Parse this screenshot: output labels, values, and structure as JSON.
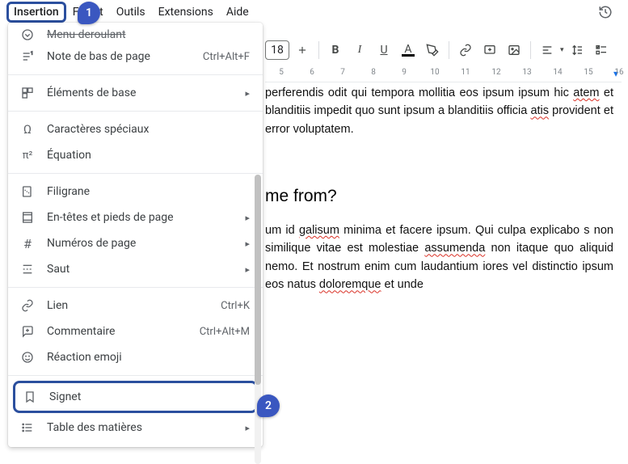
{
  "menubar": {
    "insertion": "Insertion",
    "format_partial_left": "F",
    "format_partial_right": "at",
    "outils": "Outils",
    "extensions": "Extensions",
    "aide": "Aide"
  },
  "badges": {
    "one": "1",
    "two": "2"
  },
  "toolbar": {
    "font_size": "18",
    "bold_glyph": "B",
    "italic_glyph": "I",
    "underline_glyph": "U",
    "text_color_glyph": "A"
  },
  "dropdown": {
    "truncated_top": "Menu deroulant",
    "footnote": {
      "label": "Note de bas de page",
      "shortcut": "Ctrl+Alt+F"
    },
    "building_blocks": {
      "label": "Éléments de base"
    },
    "special_chars": {
      "label": "Caractères spéciaux"
    },
    "equation": {
      "label": "Équation"
    },
    "watermark": {
      "label": "Filigrane"
    },
    "headers_footers": {
      "label": "En-têtes et pieds de page"
    },
    "page_numbers": {
      "label": "Numéros de page"
    },
    "break": {
      "label": "Saut"
    },
    "link": {
      "label": "Lien",
      "shortcut": "Ctrl+K"
    },
    "comment": {
      "label": "Commentaire",
      "shortcut": "Ctrl+Alt+M"
    },
    "emoji": {
      "label": "Réaction emoji"
    },
    "bookmark": {
      "label": "Signet"
    },
    "toc": {
      "label": "Table des matières"
    }
  },
  "ruler": {
    "ticks": [
      "5",
      "6",
      "7",
      "8",
      "9",
      "10",
      "11",
      "12",
      "13",
      "14",
      "15",
      "16"
    ]
  },
  "doc": {
    "p1_a": "perferendis odit qui tempora mollitia eos ipsum ipsum hic ",
    "p1_b": "atem",
    "p1_c": " et blanditiis impedit quo sunt ipsum a blanditiis officia ",
    "p1_d": "atis",
    "p1_e": " provident et error voluptatem.",
    "h2": "me from?",
    "p2_a": "um id ",
    "p2_w1": "galisum",
    "p2_b": " minima et facere ipsum. Qui culpa explicabo s non similique vitae est molestiae ",
    "p2_w2": "assumenda",
    "p2_c": " non itaque quo aliquid nemo. Et nostrum enim cum laudantium iores vel distinctio ipsum eos natus ",
    "p2_w3": "doloremque",
    "p2_d": " et unde"
  }
}
